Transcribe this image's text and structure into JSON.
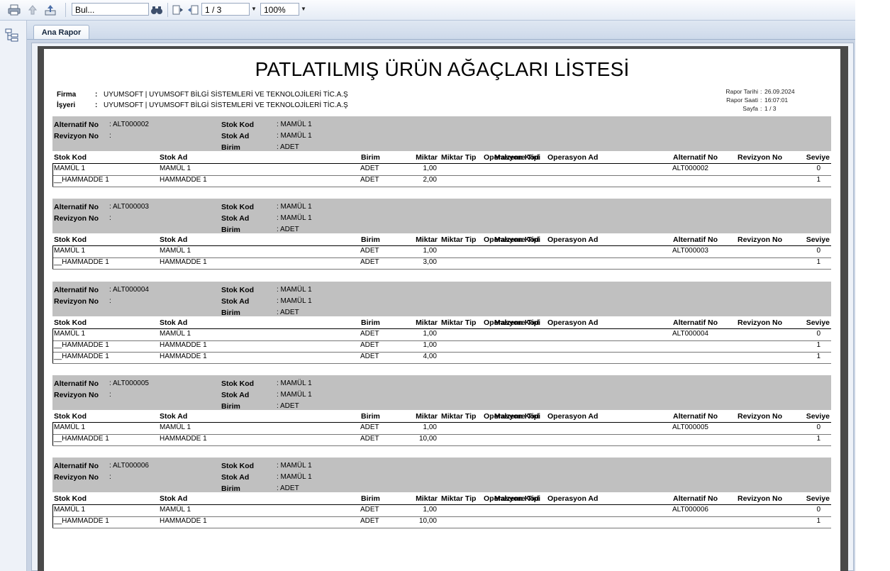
{
  "toolbar": {
    "search_value": "Bul...",
    "page_value": "1 / 3",
    "zoom_value": "100%"
  },
  "tabs": [
    {
      "label": "Ana Rapor"
    }
  ],
  "report": {
    "title": "PATLATILMIŞ ÜRÜN AĞAÇLARI LİSTESİ",
    "firma_label": "Firma",
    "firma_value": "UYUMSOFT | UYUMSOFT BİLGİ SİSTEMLERİ VE TEKNOLOJİLERİ TİC.A.Ş",
    "isyeri_label": "İşyeri",
    "isyeri_value": "UYUMSOFT | UYUMSOFT BİLGİ SİSTEMLERİ VE TEKNOLOJİLERİ TİC.A.Ş",
    "rapor_tarihi_label": "Rapor Tarihi",
    "rapor_tarihi": "26.09.2024",
    "rapor_saati_label": "Rapor Saati",
    "rapor_saati": "16:07:01",
    "sayfa_label": "Sayfa",
    "sayfa": "1 / 3"
  },
  "labels": {
    "alternatif_no": "Alternatif No",
    "revizyon_no": "Revizyon No",
    "stok_kod": "Stok Kod",
    "stok_ad": "Stok Ad",
    "birim": "Birim"
  },
  "columns": [
    "Stok Kod",
    "Stok Ad",
    "Malzeme Tipi",
    "Birim",
    "Miktar",
    "Miktar Tip",
    "Operasyon Kod",
    "Operasyon Ad",
    "Alternatif No",
    "Revizyon No",
    "Seviye"
  ],
  "blocks": [
    {
      "alternatif_no": "ALT000002",
      "revizyon_no": "",
      "stok_kod": "MAMÜL 1",
      "stok_ad": "MAMÜL 1",
      "birim": "ADET",
      "rows": [
        {
          "stok_kod": "MAMÜL 1",
          "stok_ad": "MAMÜL 1",
          "birim": "ADET",
          "miktar": "1,00",
          "alternatif_no": "ALT000002",
          "seviye": "0"
        },
        {
          "stok_kod": "__HAMMADDE 1",
          "stok_ad": "HAMMADDE 1",
          "birim": "ADET",
          "miktar": "2,00",
          "alternatif_no": "",
          "seviye": "1"
        }
      ]
    },
    {
      "alternatif_no": "ALT000003",
      "revizyon_no": "",
      "stok_kod": "MAMÜL 1",
      "stok_ad": "MAMÜL 1",
      "birim": "ADET",
      "rows": [
        {
          "stok_kod": "MAMÜL 1",
          "stok_ad": "MAMÜL 1",
          "birim": "ADET",
          "miktar": "1,00",
          "alternatif_no": "ALT000003",
          "seviye": "0"
        },
        {
          "stok_kod": "__HAMMADDE 1",
          "stok_ad": "HAMMADDE 1",
          "birim": "ADET",
          "miktar": "3,00",
          "alternatif_no": "",
          "seviye": "1"
        }
      ]
    },
    {
      "alternatif_no": "ALT000004",
      "revizyon_no": "",
      "stok_kod": "MAMÜL 1",
      "stok_ad": "MAMÜL 1",
      "birim": "ADET",
      "rows": [
        {
          "stok_kod": "MAMÜL 1",
          "stok_ad": "MAMÜL 1",
          "birim": "ADET",
          "miktar": "1,00",
          "alternatif_no": "ALT000004",
          "seviye": "0"
        },
        {
          "stok_kod": "__HAMMADDE 1",
          "stok_ad": "HAMMADDE 1",
          "birim": "ADET",
          "miktar": "1,00",
          "alternatif_no": "",
          "seviye": "1"
        },
        {
          "stok_kod": "__HAMMADDE 1",
          "stok_ad": "HAMMADDE 1",
          "birim": "ADET",
          "miktar": "4,00",
          "alternatif_no": "",
          "seviye": "1"
        }
      ]
    },
    {
      "alternatif_no": "ALT000005",
      "revizyon_no": "",
      "stok_kod": "MAMÜL 1",
      "stok_ad": "MAMÜL 1",
      "birim": "ADET",
      "rows": [
        {
          "stok_kod": "MAMÜL 1",
          "stok_ad": "MAMÜL 1",
          "birim": "ADET",
          "miktar": "1,00",
          "alternatif_no": "ALT000005",
          "seviye": "0"
        },
        {
          "stok_kod": "__HAMMADDE 1",
          "stok_ad": "HAMMADDE 1",
          "birim": "ADET",
          "miktar": "10,00",
          "alternatif_no": "",
          "seviye": "1"
        }
      ]
    },
    {
      "alternatif_no": "ALT000006",
      "revizyon_no": "",
      "stok_kod": "MAMÜL 1",
      "stok_ad": "MAMÜL 1",
      "birim": "ADET",
      "rows": [
        {
          "stok_kod": "MAMÜL 1",
          "stok_ad": "MAMÜL 1",
          "birim": "ADET",
          "miktar": "1,00",
          "alternatif_no": "ALT000006",
          "seviye": "0"
        },
        {
          "stok_kod": "__HAMMADDE 1",
          "stok_ad": "HAMMADDE 1",
          "birim": "ADET",
          "miktar": "10,00",
          "alternatif_no": "",
          "seviye": "1"
        }
      ]
    }
  ]
}
